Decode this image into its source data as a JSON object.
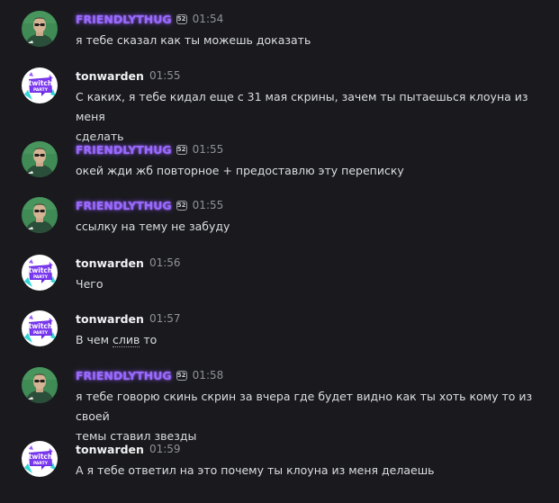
{
  "messages": [
    {
      "author": "FRIENDLYTHUG",
      "tag": "52",
      "time": "01:54",
      "text": "я тебе сказал как ты можешь доказать"
    },
    {
      "author": "tonwarden",
      "time": "01:55",
      "line1": "С каких, я тебе кидал еще с 31 мая скрины, зачем ты пытаешься клоуна из меня",
      "line2": "сделать"
    },
    {
      "author": "FRIENDLYTHUG",
      "tag": "52",
      "time": "01:55",
      "text": "окей жди жб повторное + предоставлю эту переписку"
    },
    {
      "author": "FRIENDLYTHUG",
      "tag": "52",
      "time": "01:55",
      "text": "ссылку на тему не забуду"
    },
    {
      "author": "tonwarden",
      "time": "01:56",
      "text": "Чего"
    },
    {
      "author": "tonwarden",
      "time": "01:57",
      "text_a": "В чем ",
      "text_b": "слив",
      "text_c": " то"
    },
    {
      "author": "FRIENDLYTHUG",
      "tag": "52",
      "time": "01:58",
      "line1": "я тебе говорю скинь скрин за вчера где будет видно как ты хоть кому то из своей",
      "line2": "темы ставил звезды"
    },
    {
      "author": "tonwarden",
      "time": "01:59",
      "text": "А я тебе ответил на это почему ты клоуна из меня делаешь"
    }
  ],
  "avatars": {
    "twitch_party_line1": "twitch",
    "twitch_party_line2": "PARTY"
  },
  "colors": {
    "background": "#1a1a1e",
    "friendly_name": "#9a6bff",
    "ton_name": "#f2f3f5",
    "timestamp": "#8e9297",
    "message_text": "#dbdee1"
  }
}
